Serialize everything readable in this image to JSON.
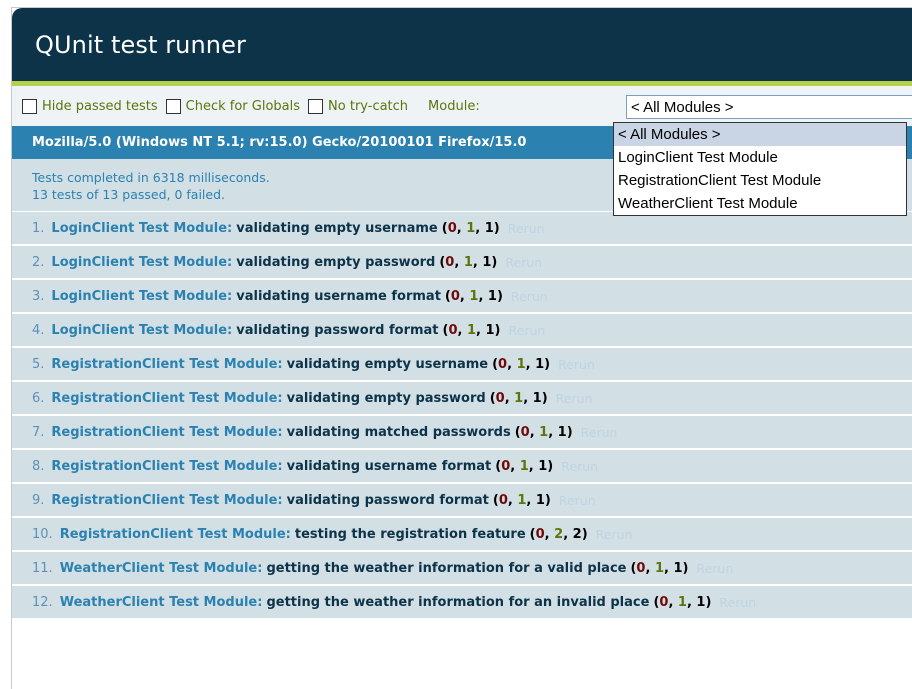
{
  "header": {
    "title": "QUnit test runner"
  },
  "toolbar": {
    "hide_passed": "Hide passed tests",
    "check_globals": "Check for Globals",
    "no_try_catch": "No try-catch",
    "module_label": "Module:",
    "module_selected": "< All Modules >",
    "module_options": [
      "< All Modules >",
      "LoginClient Test Module",
      "RegistrationClient Test Module",
      "WeatherClient Test Module"
    ]
  },
  "user_agent": "Mozilla/5.0 (Windows NT 5.1; rv:15.0) Gecko/20100101 Firefox/15.0",
  "summary": {
    "line1": "Tests completed in 6318 milliseconds.",
    "line2": "13 tests of 13 passed, 0 failed."
  },
  "rerun_label": "Rerun",
  "tests": [
    {
      "num": "1.",
      "module": "LoginClient Test Module:",
      "name": "validating empty username",
      "fail": "0",
      "pass": "1",
      "total": "1"
    },
    {
      "num": "2.",
      "module": "LoginClient Test Module:",
      "name": "validating empty password",
      "fail": "0",
      "pass": "1",
      "total": "1"
    },
    {
      "num": "3.",
      "module": "LoginClient Test Module:",
      "name": "validating username format",
      "fail": "0",
      "pass": "1",
      "total": "1"
    },
    {
      "num": "4.",
      "module": "LoginClient Test Module:",
      "name": "validating password format",
      "fail": "0",
      "pass": "1",
      "total": "1"
    },
    {
      "num": "5.",
      "module": "RegistrationClient Test Module:",
      "name": "validating empty username",
      "fail": "0",
      "pass": "1",
      "total": "1"
    },
    {
      "num": "6.",
      "module": "RegistrationClient Test Module:",
      "name": "validating empty password",
      "fail": "0",
      "pass": "1",
      "total": "1"
    },
    {
      "num": "7.",
      "module": "RegistrationClient Test Module:",
      "name": "validating matched passwords",
      "fail": "0",
      "pass": "1",
      "total": "1"
    },
    {
      "num": "8.",
      "module": "RegistrationClient Test Module:",
      "name": "validating username format",
      "fail": "0",
      "pass": "1",
      "total": "1"
    },
    {
      "num": "9.",
      "module": "RegistrationClient Test Module:",
      "name": "validating password format",
      "fail": "0",
      "pass": "1",
      "total": "1"
    },
    {
      "num": "10.",
      "module": "RegistrationClient Test Module:",
      "name": "testing the registration feature",
      "fail": "0",
      "pass": "2",
      "total": "2"
    },
    {
      "num": "11.",
      "module": "WeatherClient Test Module:",
      "name": "getting the weather information for a valid place",
      "fail": "0",
      "pass": "1",
      "total": "1"
    },
    {
      "num": "12.",
      "module": "WeatherClient Test Module:",
      "name": "getting the weather information for an invalid place",
      "fail": "0",
      "pass": "1",
      "total": "1"
    }
  ],
  "colors": {
    "header_bg": "#0d3349",
    "accent_green": "#b3d14a",
    "banner_blue": "#2b81af",
    "row_bg": "#d2e0e6",
    "fail_red": "#710909",
    "pass_green": "#5e740b"
  }
}
